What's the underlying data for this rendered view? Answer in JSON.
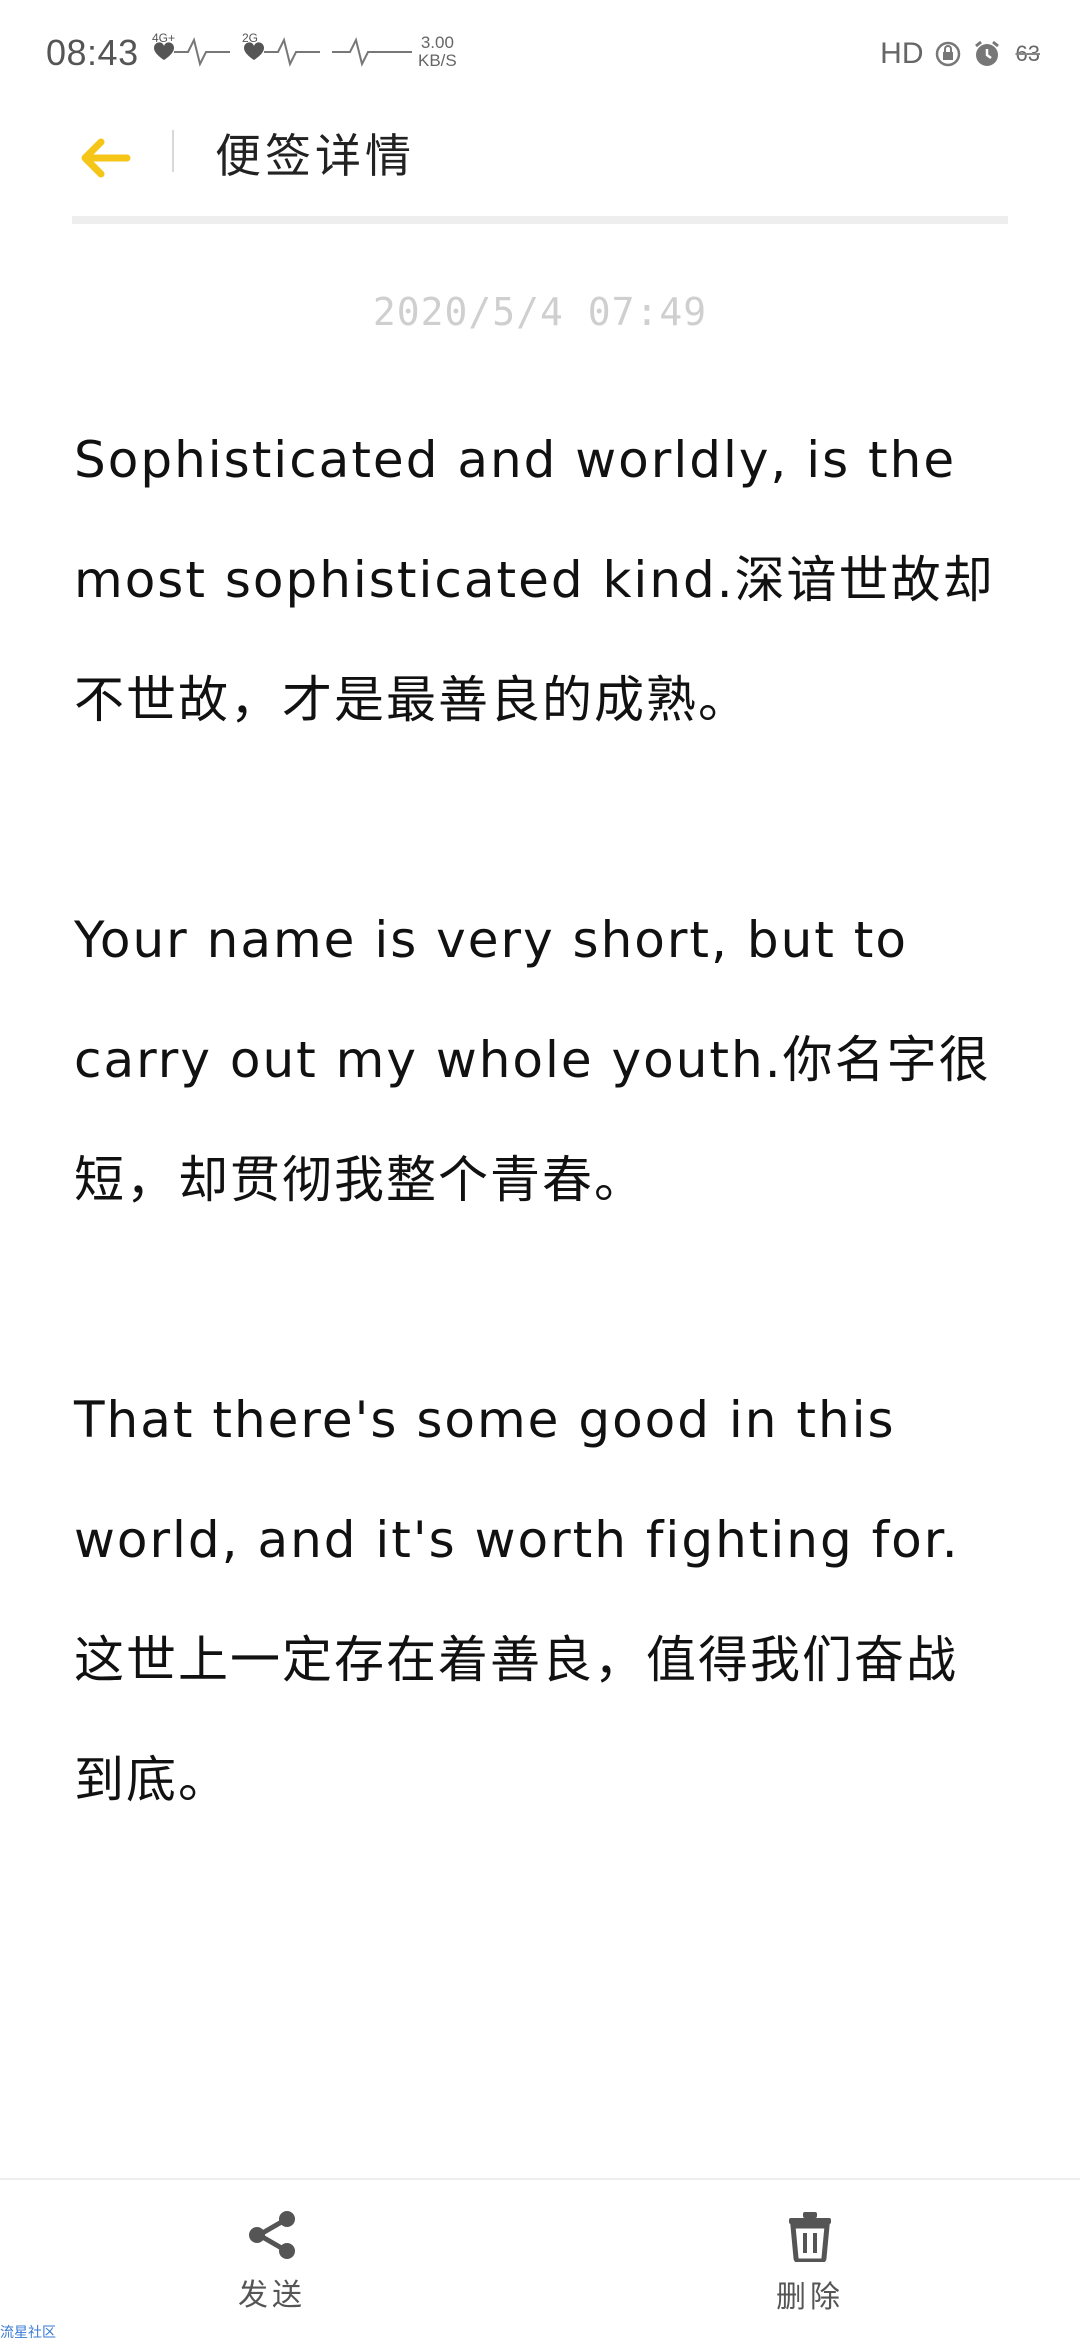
{
  "status_bar": {
    "time": "08:43",
    "signal_1_label": "4G+",
    "signal_2_label": "2G",
    "net_speed_value": "3.00",
    "net_speed_unit": "KB/S",
    "hd_label": "HD",
    "battery": "63"
  },
  "header": {
    "title": "便签详情",
    "back_icon": "arrow-left-icon",
    "accent_color": "#F5C518"
  },
  "note": {
    "date": "2020/5/4 07:49",
    "paragraphs": [
      "Sophisticated and worldly, is the most sophisticated kind.深谙世故却不世故，才是最善良的成熟。",
      "Your name is very short, but to carry out my whole youth.你名字很短，却贯彻我整个青春。",
      "That there's some good in this world, and it's worth fighting for. 这世上一定存在着善良，值得我们奋战到底。"
    ]
  },
  "toolbar": {
    "send_label": "发送",
    "send_icon": "share-icon",
    "delete_label": "删除",
    "delete_icon": "trash-icon"
  },
  "watermark": {
    "text": "流星社区"
  }
}
